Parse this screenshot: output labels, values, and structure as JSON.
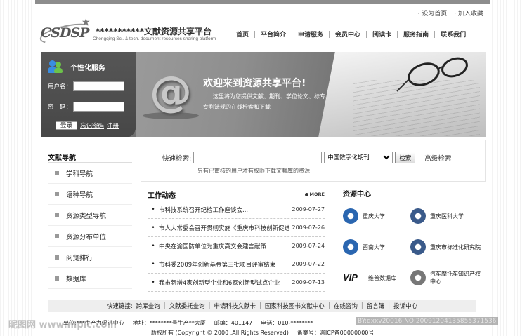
{
  "top_links": [
    "· 设为首页",
    "· 加入收藏"
  ],
  "logo": {
    "mark": "CSDSP",
    "title": "***********文献资源共享平台",
    "subtitle": "Chongqing Sci. & tech. document resources sharing platform"
  },
  "nav": [
    "首页",
    "平台简介",
    "申请服务",
    "会员中心",
    "阅读卡",
    "服务指南",
    "联系我们"
  ],
  "login": {
    "title": "个性化服务",
    "username_label": "用户名：",
    "username_value": "",
    "password_label": "密　码：",
    "password_value": "",
    "login_button": "登录",
    "forgot_link": "忘记密码",
    "register_link": "注册"
  },
  "banner": {
    "welcome": "欢迎来到资源共享平台!",
    "line1": "这里将为您提供文献、期刊、学位论文、标专、",
    "line2": "专利法规的在线检索和下载"
  },
  "left_nav": {
    "title": "文献导航",
    "items": [
      "学科导航",
      "语种导航",
      "资源类型导航",
      "资源分布单位",
      "阅览排行",
      "数据库"
    ]
  },
  "search": {
    "label": "快速检索:",
    "query": "",
    "selected_db": "中国数字化期刊",
    "button": "检索",
    "advanced": "高级检索",
    "note": "只有已审核的用户才有权限下载文献库的资源"
  },
  "news": {
    "title": "工作动态",
    "more": "MORE",
    "items": [
      {
        "text": "市科技系统召开纪检工作座谈会...",
        "date": "2009-07-27"
      },
      {
        "text": "市人大常委会召开贯彻实施《重庆市科技创新促进条例》",
        "date": "2009-07-26"
      },
      {
        "text": "中央在渝国防单位为重庆高交会建言献策",
        "date": "2009-07-24"
      },
      {
        "text": "市科委2009年创新基金第三批项目评审结束",
        "date": "2009-07-22"
      },
      {
        "text": "我市新增4家创新型企业和6家创新型试点企业",
        "date": "2009-07-13"
      }
    ]
  },
  "resources": {
    "title": "资源中心",
    "items": [
      {
        "name": "重庆大学",
        "icon": "university-seal-icon"
      },
      {
        "name": "重庆医科大学",
        "icon": "medical-university-seal-icon"
      },
      {
        "name": "西南大学",
        "icon": "university-seal-icon"
      },
      {
        "name": "重庆市标准化研究院",
        "icon": "standards-institute-icon"
      },
      {
        "name": "维普数据库",
        "icon": "vip-logo-icon",
        "logo_text": "VIP"
      },
      {
        "name": "汽车摩托车知识产权中心",
        "icon": "ip-center-icon"
      }
    ]
  },
  "footer": {
    "quick_label": "快速链接:",
    "links": [
      "跨库查询",
      "文献委托查询",
      "申请科技文献卡",
      "国家科技图书文献中心",
      "在线咨询",
      "留言簿",
      "投诉中心"
    ],
    "unit": "单位:***生产力促进中心",
    "address": "地址：********号生产**大厦",
    "postcode": "邮编：401147",
    "phone": "电话：010-********",
    "copyright": "版权所有 (Copyright © 2000 ,All Rights Reserved)",
    "icp": "备案号：渝ICP备00000000号"
  },
  "watermarks": {
    "left": "昵图网 www.nipic.com",
    "right": "BY:dxxv20016 NO:20091204135855371536"
  }
}
